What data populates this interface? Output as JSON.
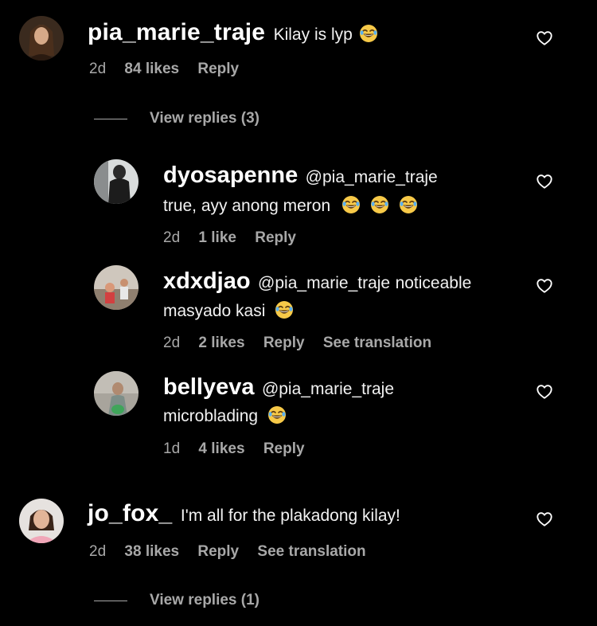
{
  "comments": [
    {
      "username": "pia_marie_traje",
      "text": "Kilay is lyp",
      "emojis": [
        "joy"
      ],
      "age": "2d",
      "likes": "84 likes",
      "reply": "Reply",
      "view_replies": "View replies (3)"
    },
    {
      "username": "jo_fox_",
      "text": "I'm all for the plakadong kilay!",
      "age": "2d",
      "likes": "38 likes",
      "reply": "Reply",
      "translation": "See translation",
      "view_replies": "View replies (1)"
    }
  ],
  "replies": [
    {
      "username": "dyosapenne",
      "mention": "@pia_marie_traje",
      "text": "true, ayy anong meron",
      "emojis": [
        "joy",
        "joy",
        "joy"
      ],
      "age": "2d",
      "likes": "1 like",
      "reply": "Reply"
    },
    {
      "username": "xdxdjao",
      "mention": "@pia_marie_traje",
      "text_inline": "noticeable",
      "text": "masyado kasi",
      "emojis": [
        "joy"
      ],
      "age": "2d",
      "likes": "2 likes",
      "reply": "Reply",
      "translation": "See translation"
    },
    {
      "username": "bellyeva",
      "mention": "@pia_marie_traje",
      "text": "microblading",
      "emojis": [
        "joy"
      ],
      "age": "1d",
      "likes": "4 likes",
      "reply": "Reply"
    }
  ],
  "icons": {
    "like": "heart-outline-icon",
    "emoji": "face-with-tears-of-joy-icon"
  },
  "colors": {
    "background": "#000000",
    "primary_text": "#ffffff",
    "secondary_text": "#a8a8a8",
    "emoji_yellow": "#f7c948"
  }
}
